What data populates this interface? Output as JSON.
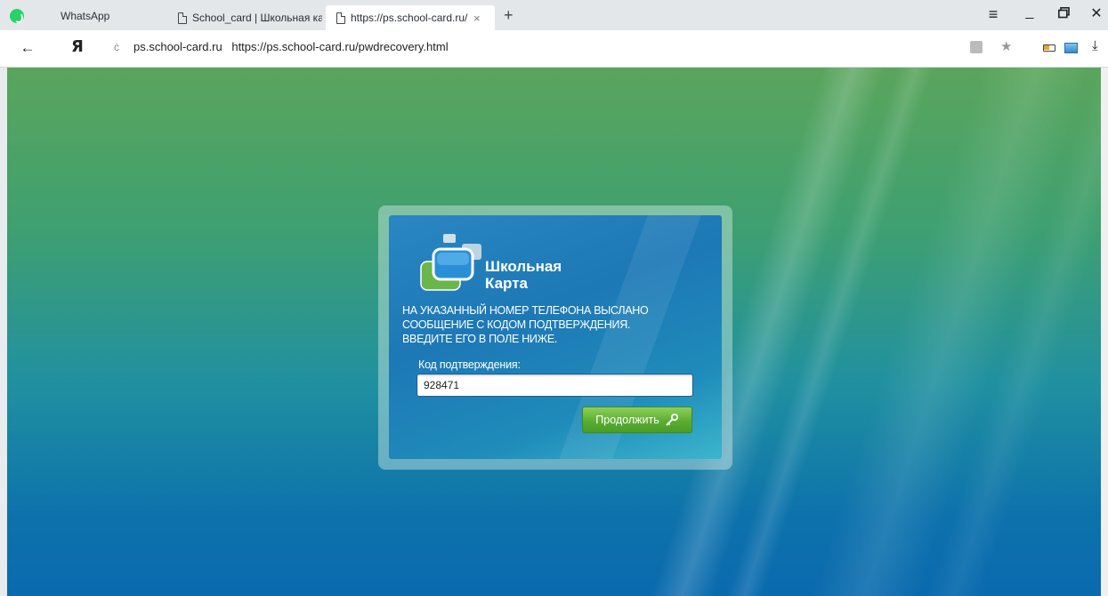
{
  "browser": {
    "tabs": [
      {
        "label": "WhatsApp",
        "icon": "whatsapp-icon"
      },
      {
        "label": "School_card | Школьная кар",
        "icon": "document-icon"
      },
      {
        "label": "https://ps.school-card.ru/",
        "icon": "document-icon",
        "active": true
      }
    ],
    "new_tab": "+",
    "close_tab": "×",
    "menu": "≡",
    "minimize": "_",
    "restore": "🗗",
    "close": "✕"
  },
  "navbar": {
    "back": "←",
    "yandex": "Я",
    "reload": "ċ",
    "url_domain": "ps.school-card.ru",
    "url_full": "https://ps.school-card.ru/pwdrecovery.html",
    "star": "★",
    "download": "⤓"
  },
  "dialog": {
    "logo_line1": "Школьная",
    "logo_line2": "Карта",
    "message_lines": [
      "НА УКАЗАННЫЙ НОМЕР ТЕЛЕФОНА ВЫСЛАНО",
      "СООБЩЕНИЕ С КОДОМ ПОДТВЕРЖДЕНИЯ.",
      "ВВЕДИТЕ ЕГО В ПОЛЕ НИЖЕ."
    ],
    "field_label": "Код подтверждения:",
    "code_value": "928471",
    "submit_label": "Продолжить"
  },
  "colors": {
    "brand_green": "#5bae32",
    "dialog_blue": "#1d78b6",
    "page_top": "#5aa55c",
    "page_bottom": "#0a6aae"
  }
}
